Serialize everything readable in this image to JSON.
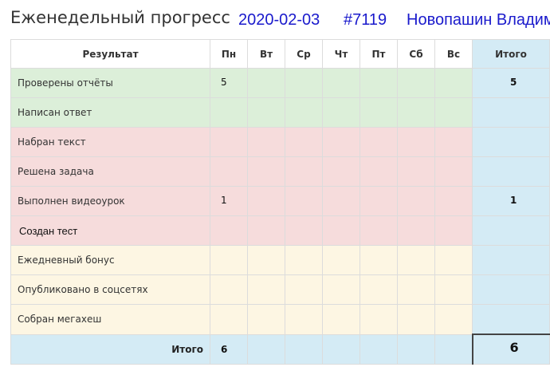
{
  "header": {
    "title": "Еженедельный прогресс",
    "date": "2020-02-03",
    "id": "#7119",
    "user": "Новопашин Владим"
  },
  "table": {
    "col_result": "Результат",
    "days": [
      "Пн",
      "Вт",
      "Ср",
      "Чт",
      "Пт",
      "Сб",
      "Вс"
    ],
    "col_total": "Итого",
    "rows": [
      {
        "label": "Проверены отчёты",
        "values": [
          "5",
          "",
          "",
          "",
          "",
          "",
          ""
        ],
        "total": "5"
      },
      {
        "label": "Написан ответ",
        "values": [
          "",
          "",
          "",
          "",
          "",
          "",
          ""
        ],
        "total": ""
      },
      {
        "label": "Набран текст",
        "values": [
          "",
          "",
          "",
          "",
          "",
          "",
          ""
        ],
        "total": ""
      },
      {
        "label": "Решена задача",
        "values": [
          "",
          "",
          "",
          "",
          "",
          "",
          ""
        ],
        "total": ""
      },
      {
        "label": "Выполнен видеоурок",
        "values": [
          "1",
          "",
          "",
          "",
          "",
          "",
          ""
        ],
        "total": "1"
      },
      {
        "label": "Создан тест",
        "values": [
          "",
          "",
          "",
          "",
          "",
          "",
          ""
        ],
        "total": ""
      },
      {
        "label": "Ежедневный бонус",
        "values": [
          "",
          "",
          "",
          "",
          "",
          "",
          ""
        ],
        "total": ""
      },
      {
        "label": "Опубликовано в соцсетях",
        "values": [
          "",
          "",
          "",
          "",
          "",
          "",
          ""
        ],
        "total": ""
      },
      {
        "label": "Собран мегахеш",
        "values": [
          "",
          "",
          "",
          "",
          "",
          "",
          ""
        ],
        "total": ""
      }
    ],
    "sum_label": "Итого",
    "sum_values": [
      "6",
      "",
      "",
      "",
      "",
      "",
      ""
    ],
    "sum_total": "6"
  },
  "colors": {
    "group_1": "#dcefd9",
    "group_2": "#f6dcdc",
    "group_3": "#fdf6e3",
    "total_column": "#d4ebf5",
    "link": "#1a1acc"
  }
}
